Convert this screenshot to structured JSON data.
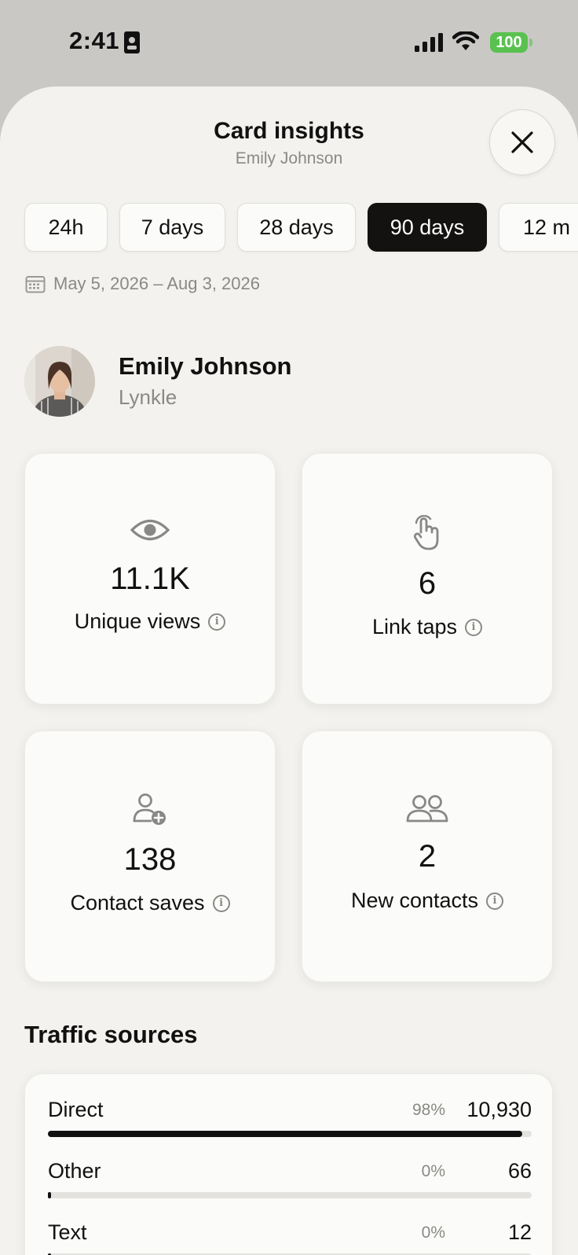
{
  "status_bar": {
    "time": "2:41",
    "battery": "100"
  },
  "sheet": {
    "title": "Card insights",
    "subtitle": "Emily Johnson"
  },
  "ranges": [
    {
      "label": "24h",
      "active": false
    },
    {
      "label": "7 days",
      "active": false
    },
    {
      "label": "28 days",
      "active": false
    },
    {
      "label": "90 days",
      "active": true
    },
    {
      "label": "12 m",
      "active": false
    }
  ],
  "date_range": "May 5, 2026 – Aug 3, 2026",
  "profile": {
    "name": "Emily Johnson",
    "company": "Lynkle"
  },
  "stats": [
    {
      "icon": "eye-icon",
      "value": "11.1K",
      "label": "Unique views"
    },
    {
      "icon": "tap-hand-icon",
      "value": "6",
      "label": "Link taps"
    },
    {
      "icon": "add-contact-icon",
      "value": "138",
      "label": "Contact saves"
    },
    {
      "icon": "users-icon",
      "value": "2",
      "label": "New contacts"
    }
  ],
  "traffic": {
    "title": "Traffic sources",
    "rows": [
      {
        "name": "Direct",
        "percent": "98%",
        "count": "10,930",
        "fraction": 0.98
      },
      {
        "name": "Other",
        "percent": "0%",
        "count": "66",
        "fraction": 0.006
      },
      {
        "name": "Text",
        "percent": "0%",
        "count": "12",
        "fraction": 0.001
      }
    ]
  }
}
